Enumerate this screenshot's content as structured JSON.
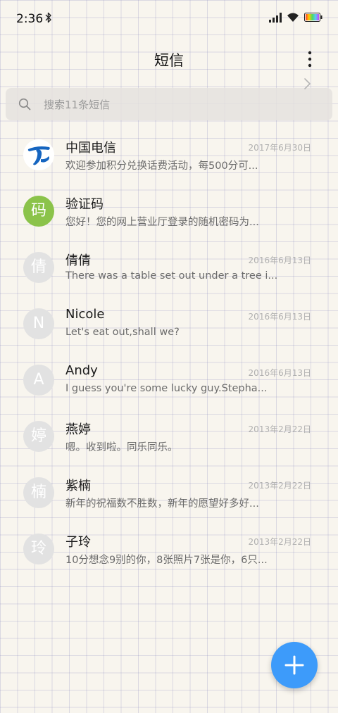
{
  "status_bar": {
    "time": "2:36"
  },
  "header": {
    "title": "短信"
  },
  "search": {
    "placeholder": "搜索11条短信"
  },
  "conversations": [
    {
      "name": "中国电信",
      "preview": "欢迎参加积分兑换话费活动，每500分可...",
      "date": "2017年6月30日",
      "avatar_text": "",
      "avatar_icon": "china-telecom-logo-icon"
    },
    {
      "name": "验证码",
      "preview": "您好！您的网上营业厅登录的随机密码为...",
      "date": "",
      "avatar_text": "码"
    },
    {
      "name": "倩倩",
      "preview": "There was a table set out under a tree i...",
      "date": "2016年6月13日",
      "avatar_text": "倩"
    },
    {
      "name": "Nicole",
      "preview": "Let's eat out,shall we?",
      "date": "2016年6月13日",
      "avatar_text": "N"
    },
    {
      "name": "Andy",
      "preview": "I guess you're some lucky guy.Stepha...",
      "date": "2016年6月13日",
      "avatar_text": "A"
    },
    {
      "name": "燕婷",
      "preview": "嗯。收到啦。同乐同乐。",
      "date": "2013年2月22日",
      "avatar_text": "婷"
    },
    {
      "name": "紫楠",
      "preview": "新年的祝福数不胜数，新年的愿望好多好...",
      "date": "2013年2月22日",
      "avatar_text": "楠"
    },
    {
      "name": "子玲",
      "preview": "10分想念9别的你，8张照片7张是你，6只...",
      "date": "2013年2月22日",
      "avatar_text": "玲"
    }
  ],
  "colors": {
    "accent": "#3d9bfa",
    "avatar_green": "#8bc34a",
    "avatar_grey": "#e2e2e2",
    "telecom_blue": "#1565c0"
  },
  "icons": {
    "fab": "plus-icon",
    "more": "more-vert-icon",
    "search": "search-icon",
    "verification_row": "chevron-right-icon"
  }
}
